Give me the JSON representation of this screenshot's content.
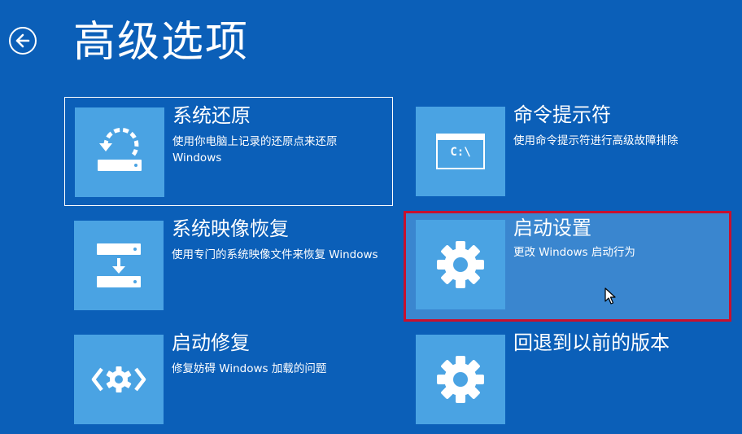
{
  "page": {
    "title": "高级选项",
    "back_icon": "arrow-left-icon"
  },
  "colors": {
    "background": "#0b5fb8",
    "tile_icon_bg": "#4aa3e3",
    "hover_bg": "#3a86cf",
    "hover_border": "#c8102e"
  },
  "tiles": [
    {
      "title": "系统还原",
      "desc": "使用你电脑上记录的还原点来还原 Windows",
      "icon": "system-restore-icon"
    },
    {
      "title": "命令提示符",
      "desc": "使用命令提示符进行高级故障排除",
      "icon": "command-prompt-icon",
      "icon_text": "C:\\"
    },
    {
      "title": "系统映像恢复",
      "desc": "使用专门的系统映像文件来恢复 Windows",
      "icon": "system-image-recovery-icon"
    },
    {
      "title": "启动设置",
      "desc": "更改 Windows 启动行为",
      "icon": "gear-icon"
    },
    {
      "title": "启动修复",
      "desc": "修复妨碍 Windows 加载的问题",
      "icon": "startup-repair-icon"
    },
    {
      "title": "回退到以前的版本",
      "desc": "",
      "icon": "gear-icon"
    }
  ]
}
